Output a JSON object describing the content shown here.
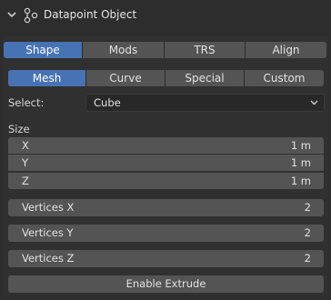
{
  "panel": {
    "title": "Datapoint Object"
  },
  "main_tabs": [
    {
      "label": "Shape",
      "active": true
    },
    {
      "label": "Mods",
      "active": false
    },
    {
      "label": "TRS",
      "active": false
    },
    {
      "label": "Align",
      "active": false
    }
  ],
  "sub_tabs": [
    {
      "label": "Mesh",
      "active": true
    },
    {
      "label": "Curve",
      "active": false
    },
    {
      "label": "Special",
      "active": false
    },
    {
      "label": "Custom",
      "active": false
    }
  ],
  "select": {
    "label": "Select:",
    "value": "Cube"
  },
  "size": {
    "label": "Size",
    "x": {
      "label": "X",
      "value": "1 m"
    },
    "y": {
      "label": "Y",
      "value": "1 m"
    },
    "z": {
      "label": "Z",
      "value": "1 m"
    }
  },
  "vertices": {
    "x": {
      "label": "Vertices X",
      "value": "2"
    },
    "y": {
      "label": "Vertices Y",
      "value": "2"
    },
    "z": {
      "label": "Vertices Z",
      "value": "2"
    }
  },
  "extrude_button": "Enable Extrude",
  "colors": {
    "accent": "#4772b3",
    "background": "#2d2d2d",
    "widget": "#545454"
  }
}
